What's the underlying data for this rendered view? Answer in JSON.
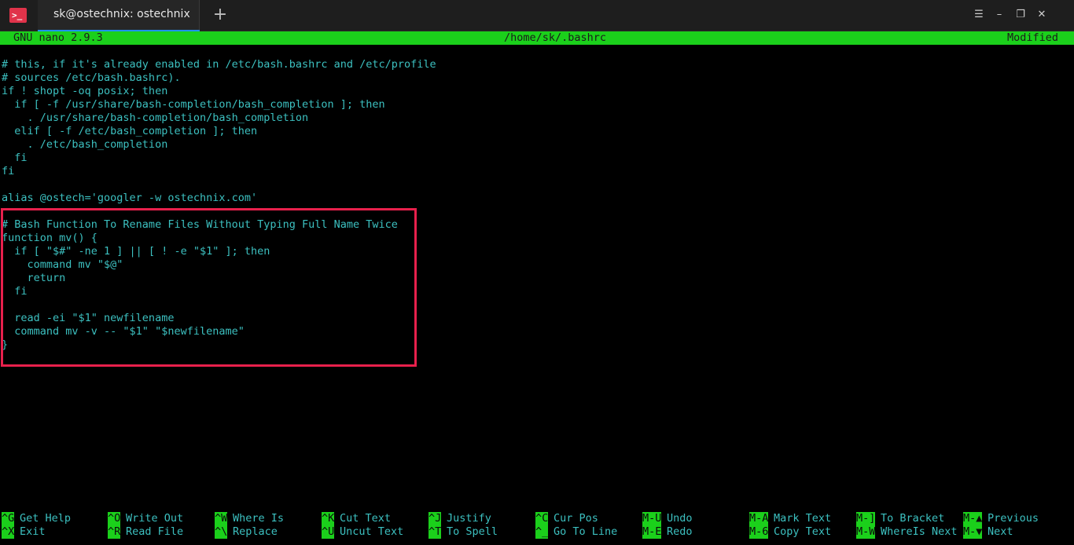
{
  "window": {
    "tab_title": "sk@ostechnix: ostechnix",
    "app_icon_glyph": ">_",
    "new_tab_glyph": "+",
    "search_glyph": "☰",
    "minimize_glyph": "–",
    "restore_glyph": "❐",
    "close_glyph": "✕",
    "accent_color": "#1e90ff"
  },
  "nano": {
    "version_label": "GNU nano 2.9.3",
    "file_path": "/home/sk/.bashrc",
    "status": "Modified",
    "header_color": "#1bd01b"
  },
  "editor": {
    "text_color": "#3cc0c0",
    "highlight_color": "#e8204c",
    "lines": [
      "# this, if it's already enabled in /etc/bash.bashrc and /etc/profile",
      "# sources /etc/bash.bashrc).",
      "if ! shopt -oq posix; then",
      "  if [ -f /usr/share/bash-completion/bash_completion ]; then",
      "    . /usr/share/bash-completion/bash_completion",
      "  elif [ -f /etc/bash_completion ]; then",
      "    . /etc/bash_completion",
      "  fi",
      "fi",
      "",
      "alias @ostech='googler -w ostechnix.com'",
      "",
      "# Bash Function To Rename Files Without Typing Full Name Twice",
      "function mv() {",
      "  if [ \"$#\" -ne 1 ] || [ ! -e \"$1\" ]; then",
      "    command mv \"$@\"",
      "    return",
      "  fi",
      "",
      "  read -ei \"$1\" newfilename",
      "  command mv -v -- \"$1\" \"$newfilename\"",
      "}"
    ]
  },
  "shortcuts": {
    "row1": [
      {
        "key": "^G",
        "label": "Get Help"
      },
      {
        "key": "^O",
        "label": "Write Out"
      },
      {
        "key": "^W",
        "label": "Where Is"
      },
      {
        "key": "^K",
        "label": "Cut Text"
      },
      {
        "key": "^J",
        "label": "Justify"
      },
      {
        "key": "^C",
        "label": "Cur Pos"
      },
      {
        "key": "M-U",
        "label": "Undo"
      },
      {
        "key": "M-A",
        "label": "Mark Text"
      },
      {
        "key": "M-]",
        "label": "To Bracket"
      },
      {
        "key": "M-▲",
        "label": "Previous"
      }
    ],
    "row2": [
      {
        "key": "^X",
        "label": "Exit"
      },
      {
        "key": "^R",
        "label": "Read File"
      },
      {
        "key": "^\\",
        "label": "Replace"
      },
      {
        "key": "^U",
        "label": "Uncut Text"
      },
      {
        "key": "^T",
        "label": "To Spell"
      },
      {
        "key": "^_",
        "label": "Go To Line"
      },
      {
        "key": "M-E",
        "label": "Redo"
      },
      {
        "key": "M-6",
        "label": "Copy Text"
      },
      {
        "key": "M-W",
        "label": "WhereIs Next"
      },
      {
        "key": "M-▼",
        "label": "Next"
      }
    ]
  }
}
